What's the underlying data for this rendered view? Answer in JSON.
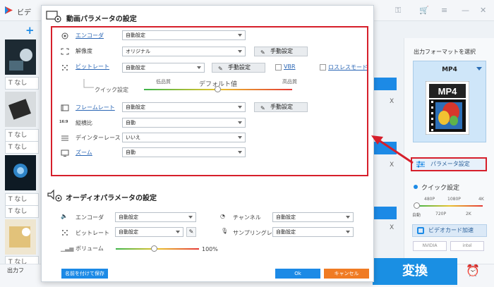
{
  "app": {
    "title": "ビデ",
    "plus": "+",
    "no_sub_label": "なし",
    "output_label": "出力フ",
    "convert_label": "変換",
    "list_x": "X"
  },
  "right_panel": {
    "output_format_label": "出力フォーマットを選択",
    "format_name": "MP4",
    "mp4_icon_text": "MP4",
    "param_button": "パラメータ設定",
    "quick_title": "クイック設定",
    "ticks_top": [
      "480P",
      "1080P",
      "4K"
    ],
    "ticks_bottom": [
      "自動",
      "720P",
      "2K"
    ],
    "gpu_button": "ビデオカード加速",
    "gpu_chips": [
      "NVIDIA",
      "intel"
    ]
  },
  "dialog": {
    "video_section_title": "動画パラメータの設定",
    "encoder_label": "エンコーダ",
    "encoder_value": "自動設定",
    "resolution_label": "解像度",
    "resolution_value": "オリジナル",
    "manual_label": "手動設定",
    "bitrate_label": "ビットレート",
    "bitrate_value": "自動設定",
    "vbr_label": "VBR",
    "lossless_label": "ロスレスモード",
    "low_quality": "低品質",
    "high_quality": "高品質",
    "default_label": "デフォルト値",
    "quick_setting_label": "クイック設定",
    "framerate_label": "フレームレート",
    "framerate_value": "自動設定",
    "aspect_label": "縦横比",
    "aspect_value": "自動",
    "deinterlace_label": "デインターレース",
    "deinterlace_value": "いいえ",
    "zoom_label": "ズーム",
    "zoom_value": "自動",
    "audio_section_title": "オーディオパラメータの設定",
    "a_encoder_label": "エンコーダ",
    "a_encoder_value": "自動設定",
    "channel_label": "チャンネル",
    "channel_value": "自動設定",
    "a_bitrate_label": "ビットレート",
    "a_bitrate_value": "自動設定",
    "sampling_label": "サンプリングレート",
    "sampling_value": "自動設定",
    "volume_label": "ボリューム",
    "volume_value": "100%",
    "save_as_button": "名前を付けて保存",
    "ok_button": "Ok",
    "cancel_button": "キャンセル"
  },
  "quick_slider_level": 0.5,
  "volume_level": 0.47
}
